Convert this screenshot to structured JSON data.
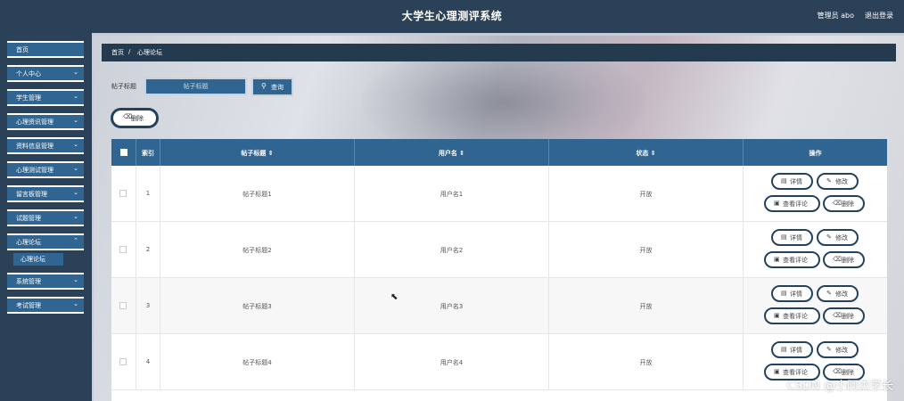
{
  "header": {
    "title": "大学生心理测评系统",
    "user": "管理员 abo",
    "logout": "退出登录"
  },
  "sidebar": {
    "items": [
      {
        "label": "首页",
        "chevron": ""
      },
      {
        "label": "个人中心",
        "chevron": "⌄"
      },
      {
        "label": "学生管理",
        "chevron": "⌄"
      },
      {
        "label": "心理资讯管理",
        "chevron": "⌄"
      },
      {
        "label": "资料信息管理",
        "chevron": "⌄"
      },
      {
        "label": "心理测试管理",
        "chevron": "⌄"
      },
      {
        "label": "留言板管理",
        "chevron": "⌄"
      },
      {
        "label": "试题管理",
        "chevron": "⌄"
      },
      {
        "label": "心理论坛",
        "chevron": "⌃"
      },
      {
        "label": "系统管理",
        "chevron": "⌄"
      },
      {
        "label": "考试管理",
        "chevron": "⌄"
      }
    ],
    "submenu": {
      "label": "心理论坛"
    }
  },
  "breadcrumb": {
    "home": "首页",
    "separator": "/",
    "current": "心理论坛"
  },
  "search": {
    "label": "帖子标题",
    "placeholder": "帖子标题",
    "query_icon": "search-icon",
    "query_label": "查询"
  },
  "toolbar": {
    "delete_icon": "trash-icon",
    "delete_label": "删除"
  },
  "table": {
    "headers": {
      "index": "索引",
      "title": "帖子标题 ⇕",
      "username": "用户名 ⇕",
      "status": "状态 ⇕",
      "actions": "操作"
    },
    "rows": [
      {
        "index": "1",
        "title": "帖子标题1",
        "username": "用户名1",
        "status": "开放"
      },
      {
        "index": "2",
        "title": "帖子标题2",
        "username": "用户名2",
        "status": "开放"
      },
      {
        "index": "3",
        "title": "帖子标题3",
        "username": "用户名3",
        "status": "开放"
      },
      {
        "index": "4",
        "title": "帖子标题4",
        "username": "用户名4",
        "status": "开放"
      }
    ],
    "actions": {
      "detail": "详情",
      "edit": "修改",
      "comments": "查看评论",
      "delete": "删除"
    }
  },
  "icons": {
    "detail": "▤",
    "edit": "✎",
    "comments": "▣",
    "delete": "⌫",
    "search": "⚲",
    "cursor": "⬉"
  },
  "watermark": "CSDN @小阿杰学长",
  "colors": {
    "header_bg": "#2b4157",
    "accent": "#2f6590",
    "button_border": "#24415e"
  }
}
